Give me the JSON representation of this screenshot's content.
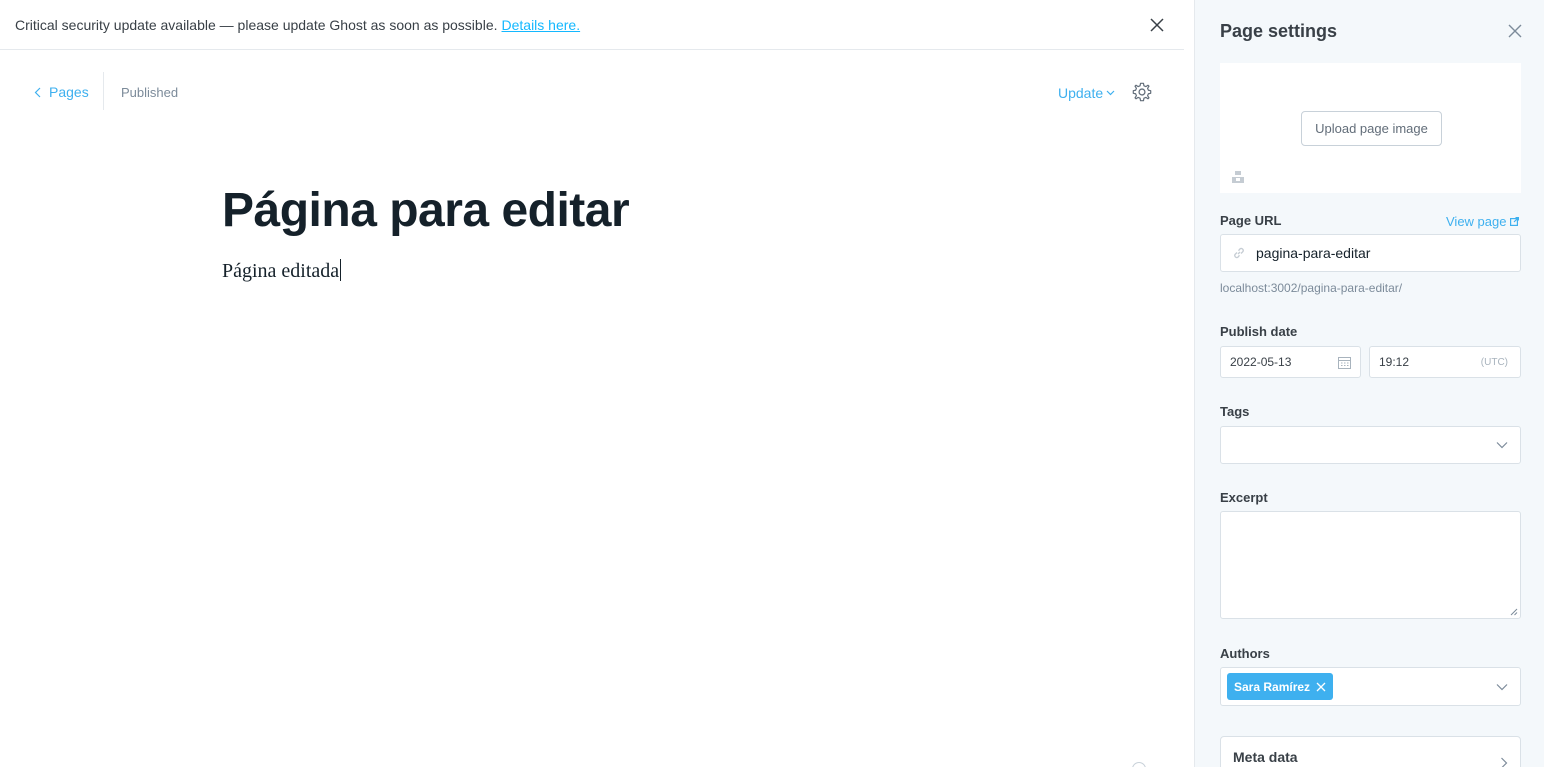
{
  "banner": {
    "message": "Critical security update available — please update Ghost as soon as possible.",
    "link_text": "Details here."
  },
  "header": {
    "back_label": "Pages",
    "status": "Published",
    "update_label": "Update"
  },
  "editor": {
    "title": "Página para editar",
    "body": "Página editada"
  },
  "sidebar": {
    "title": "Page settings",
    "upload_label": "Upload page image",
    "url_label": "Page URL",
    "view_page_label": "View page",
    "url_value": "pagina-para-editar",
    "url_hint": "localhost:3002/pagina-para-editar/",
    "publish_label": "Publish date",
    "date_value": "2022-05-13",
    "time_value": "19:12",
    "timezone": "(UTC)",
    "tags_label": "Tags",
    "excerpt_label": "Excerpt",
    "authors_label": "Authors",
    "authors": [
      "Sara Ramírez"
    ],
    "meta_label": "Meta data"
  },
  "colors": {
    "accent": "#3eb0ef",
    "banner_link": "#14b8ff",
    "sidebar_bg": "#f4f8fb"
  }
}
